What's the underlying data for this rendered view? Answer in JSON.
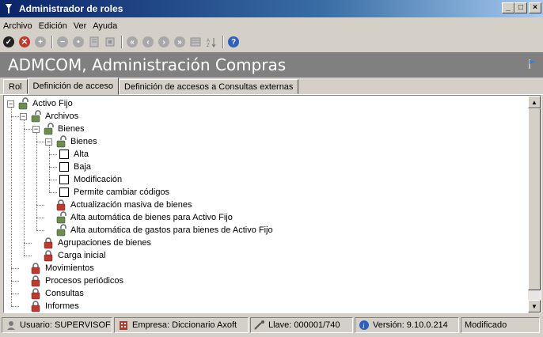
{
  "window": {
    "title": "Administrador de roles",
    "controls": {
      "minimize": "_",
      "maximize": "□",
      "close": "×"
    }
  },
  "menu": [
    "Archivo",
    "Edición",
    "Ver",
    "Ayuda"
  ],
  "toolbar": {
    "icons": [
      "check-icon",
      "cancel-icon",
      "add-icon",
      "remove-icon",
      "apply-icon",
      "document-icon",
      "copy-icon",
      "first-icon",
      "previous-icon",
      "next-icon",
      "last-icon",
      "grid-icon",
      "sort-az-icon",
      "help-icon"
    ]
  },
  "banner": {
    "title": "ADMCOM, Administración Compras"
  },
  "tabs": [
    {
      "label": "Rol",
      "active": false
    },
    {
      "label": "Definición de acceso",
      "active": true
    },
    {
      "label": "Definición de accesos a Consultas externas",
      "active": false
    }
  ],
  "tree": {
    "nodes": [
      {
        "label": "Activo Fijo",
        "expander": "−",
        "icon": "lock-open-icon"
      },
      {
        "label": "Archivos",
        "expander": "−",
        "icon": "lock-open-icon"
      },
      {
        "label": "Bienes",
        "expander": "−",
        "icon": "lock-open-icon"
      },
      {
        "label": "Bienes",
        "expander": "−",
        "icon": "lock-open-icon"
      },
      {
        "label": "Alta",
        "icon": "checkbox"
      },
      {
        "label": "Baja",
        "icon": "checkbox"
      },
      {
        "label": "Modificación",
        "icon": "checkbox"
      },
      {
        "label": "Permite cambiar códigos",
        "icon": "checkbox"
      },
      {
        "label": "Actualización masiva de bienes",
        "icon": "lock-closed-icon"
      },
      {
        "label": "Alta automática de bienes para Activo Fijo",
        "icon": "lock-open-icon"
      },
      {
        "label": "Alta automática de gastos para bienes de Activo Fijo",
        "icon": "lock-open-icon"
      },
      {
        "label": "Agrupaciones de bienes",
        "icon": "lock-closed-icon"
      },
      {
        "label": "Carga inicial",
        "icon": "lock-closed-icon"
      },
      {
        "label": "Movimientos",
        "icon": "lock-closed-icon"
      },
      {
        "label": "Procesos periódicos",
        "icon": "lock-closed-icon"
      },
      {
        "label": "Consultas",
        "icon": "lock-closed-icon"
      },
      {
        "label": "Informes",
        "icon": "lock-closed-icon"
      }
    ]
  },
  "status": {
    "usuario": "Usuario: SUPERVISOF",
    "empresa": "Empresa: Diccionario Axoft",
    "llave": "Llave: 000001/740",
    "version": "Versión: 9.10.0.214",
    "estado": "Modificado"
  },
  "colors": {
    "titlebar_start": "#0a246a",
    "banner_bg": "#808080",
    "lock_open": "#6b8e4e",
    "lock_closed": "#c0392b"
  }
}
